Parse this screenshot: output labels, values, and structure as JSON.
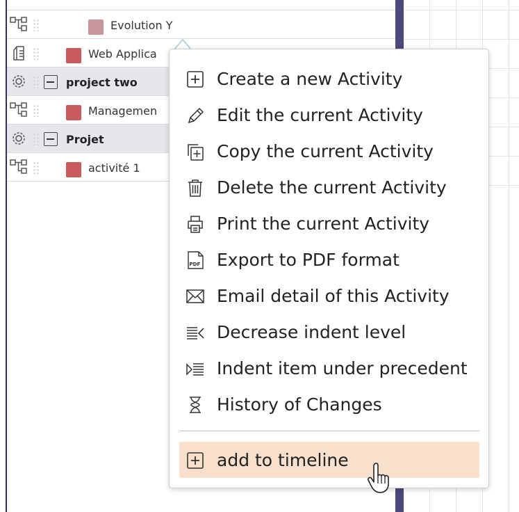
{
  "rows": [
    {
      "name": "Evolution Y",
      "type": "task",
      "color": "#c9969c"
    },
    {
      "name": "Web Applica",
      "type": "task",
      "color": "#c95b5f"
    },
    {
      "name": "project two",
      "type": "project"
    },
    {
      "name": "Managemen",
      "type": "task",
      "color": "#c95b5f"
    },
    {
      "name": "Projet",
      "type": "project"
    },
    {
      "name": "activité 1",
      "type": "task",
      "color": "#c95b5f"
    }
  ],
  "menu": {
    "items": [
      {
        "label": "Create a new Activity",
        "icon": "plus-box-icon"
      },
      {
        "label": "Edit the current Activity",
        "icon": "pencil-icon"
      },
      {
        "label": "Copy the current Activity",
        "icon": "copy-icon"
      },
      {
        "label": "Delete the current Activity",
        "icon": "trash-icon"
      },
      {
        "label": "Print the current Activity",
        "icon": "printer-icon"
      },
      {
        "label": "Export to PDF format",
        "icon": "pdf-icon"
      },
      {
        "label": "Email detail of this Activity",
        "icon": "envelope-icon"
      },
      {
        "label": "Decrease indent level",
        "icon": "outdent-icon"
      },
      {
        "label": "Indent item under precedent",
        "icon": "indent-icon"
      },
      {
        "label": "History of Changes",
        "icon": "hourglass-icon"
      }
    ],
    "footer_item": {
      "label": "add to timeline",
      "icon": "plus-box-icon"
    }
  },
  "colors": {
    "highlight": "#f9e0cc",
    "today_bar": "#4b4a7c"
  }
}
